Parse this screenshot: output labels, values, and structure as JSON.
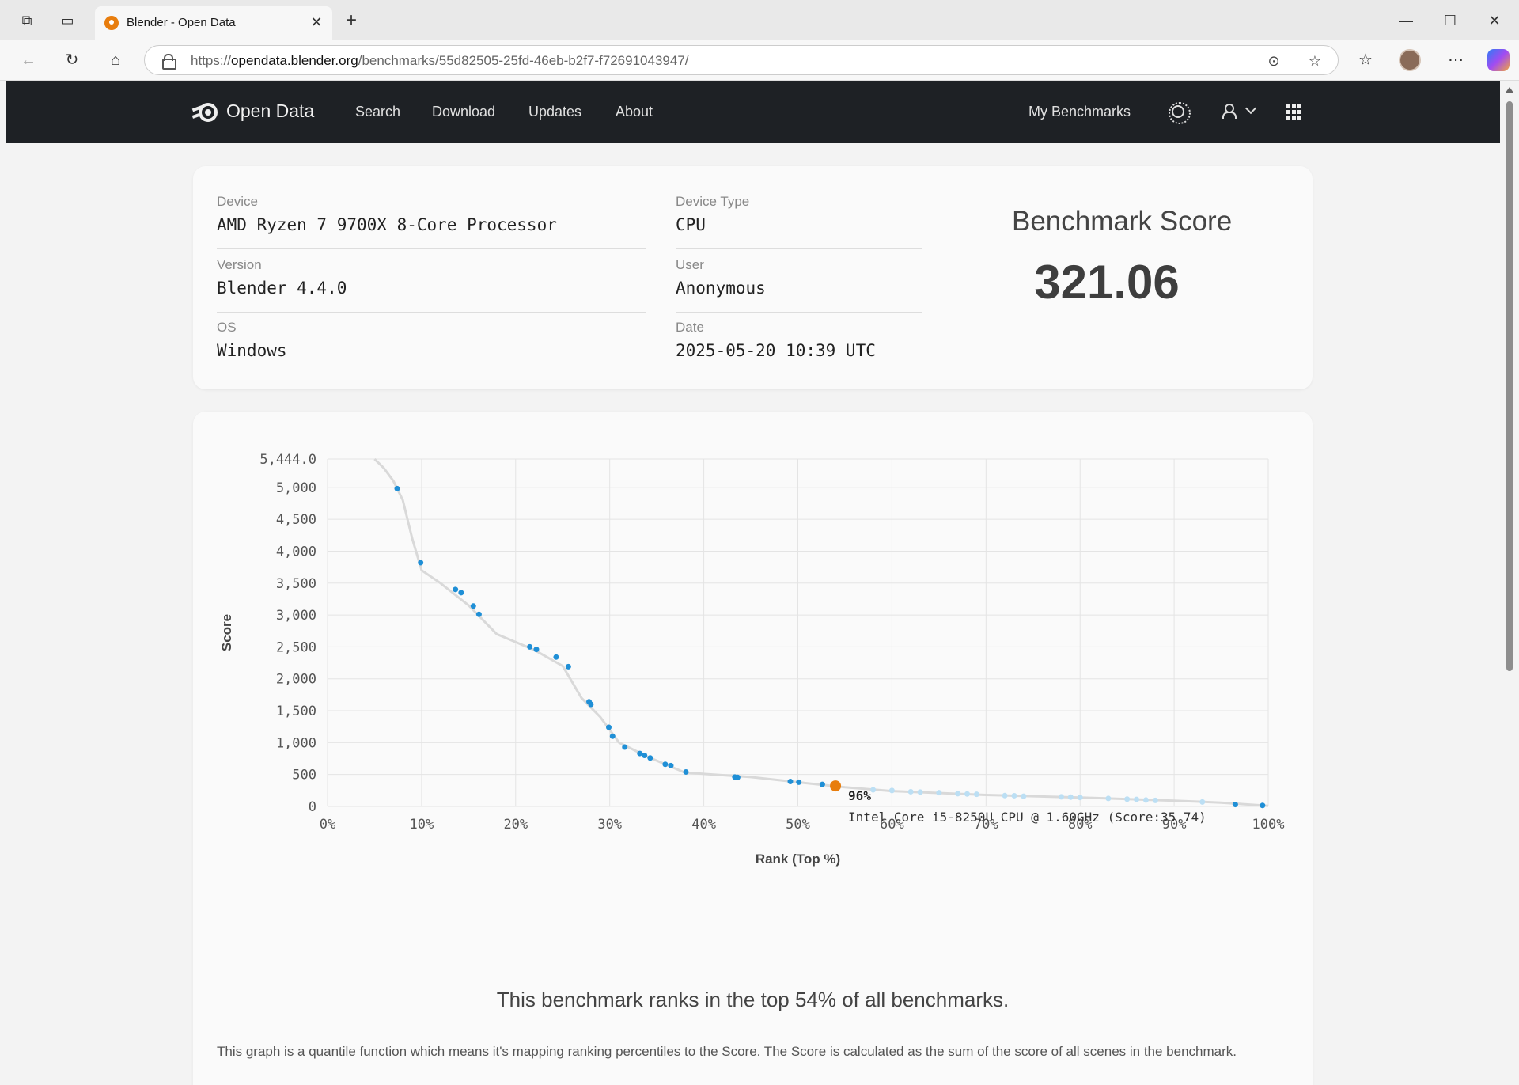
{
  "browser": {
    "tab_title": "Blender - Open Data",
    "url_prefix": "https://",
    "url_host": "opendata.blender.org",
    "url_path": "/benchmarks/55d82505-25fd-46eb-b2f7-f72691043947/"
  },
  "nav": {
    "brand": "Open Data",
    "links": [
      "Search",
      "Download",
      "Updates",
      "About"
    ],
    "my_benchmarks": "My Benchmarks"
  },
  "info": {
    "device_label": "Device",
    "device_value": "AMD Ryzen 7 9700X 8-Core Processor",
    "version_label": "Version",
    "version_value": "Blender 4.4.0",
    "os_label": "OS",
    "os_value": "Windows",
    "device_type_label": "Device Type",
    "device_type_value": "CPU",
    "user_label": "User",
    "user_value": "Anonymous",
    "date_label": "Date",
    "date_value": "2025-05-20 10:39 UTC",
    "score_title": "Benchmark Score",
    "score_value": "321.06"
  },
  "chart_data": {
    "type": "scatter",
    "xlabel": "Rank (Top %)",
    "ylabel": "Score",
    "xlim": [
      0,
      100
    ],
    "ylim": [
      0,
      5444
    ],
    "x_ticks": [
      "0%",
      "10%",
      "20%",
      "30%",
      "40%",
      "50%",
      "60%",
      "70%",
      "80%",
      "90%",
      "100%"
    ],
    "y_ticks": [
      "0",
      "500",
      "1,000",
      "1,500",
      "2,000",
      "2,500",
      "3,000",
      "3,500",
      "4,000",
      "4,500",
      "5,000",
      "5,444.0"
    ],
    "y_tick_values": [
      0,
      500,
      1000,
      1500,
      2000,
      2500,
      3000,
      3500,
      4000,
      4500,
      5000,
      5444
    ],
    "curve": [
      [
        5,
        5444
      ],
      [
        6,
        5300
      ],
      [
        7,
        5100
      ],
      [
        8,
        4800
      ],
      [
        9,
        4200
      ],
      [
        10,
        3700
      ],
      [
        12,
        3500
      ],
      [
        15,
        3150
      ],
      [
        18,
        2700
      ],
      [
        22,
        2450
      ],
      [
        25,
        2200
      ],
      [
        27,
        1700
      ],
      [
        29,
        1400
      ],
      [
        31,
        1000
      ],
      [
        34,
        780
      ],
      [
        38,
        530
      ],
      [
        45,
        460
      ],
      [
        50,
        380
      ],
      [
        55,
        300
      ],
      [
        60,
        240
      ],
      [
        70,
        180
      ],
      [
        80,
        140
      ],
      [
        90,
        90
      ],
      [
        95,
        60
      ],
      [
        100,
        10
      ]
    ],
    "points": [
      [
        7.4,
        4980
      ],
      [
        9.9,
        3820
      ],
      [
        13.6,
        3400
      ],
      [
        14.2,
        3350
      ],
      [
        15.5,
        3140
      ],
      [
        16.1,
        3010
      ],
      [
        21.5,
        2500
      ],
      [
        22.2,
        2460
      ],
      [
        24.3,
        2340
      ],
      [
        25.6,
        2190
      ],
      [
        27.8,
        1640
      ],
      [
        28,
        1600
      ],
      [
        29.9,
        1240
      ],
      [
        30.3,
        1100
      ],
      [
        31.6,
        930
      ],
      [
        33.2,
        830
      ],
      [
        33.7,
        800
      ],
      [
        34.3,
        760
      ],
      [
        35.9,
        660
      ],
      [
        36.5,
        640
      ],
      [
        38.1,
        540
      ],
      [
        43.3,
        460
      ],
      [
        43.6,
        455
      ],
      [
        49.2,
        390
      ],
      [
        50.1,
        380
      ],
      [
        52.6,
        345
      ],
      [
        96.5,
        30
      ],
      [
        99.4,
        15
      ]
    ],
    "faded_points": [
      [
        58,
        260
      ],
      [
        60,
        250
      ],
      [
        62,
        230
      ],
      [
        63,
        225
      ],
      [
        65,
        215
      ],
      [
        67,
        200
      ],
      [
        68,
        195
      ],
      [
        69,
        190
      ],
      [
        72,
        170
      ],
      [
        73,
        168
      ],
      [
        74,
        160
      ],
      [
        78,
        150
      ],
      [
        79,
        145
      ],
      [
        80,
        140
      ],
      [
        83,
        125
      ],
      [
        85,
        115
      ],
      [
        86,
        110
      ],
      [
        87,
        100
      ],
      [
        88,
        95
      ],
      [
        93,
        70
      ]
    ],
    "highlight": {
      "x": 54,
      "y": 321.06
    },
    "tooltip_percent": "96%",
    "tooltip_label": "Intel Core i5-8250U CPU @ 1.60GHz (Score:35.74)",
    "colors": {
      "point": "#1f8fd6",
      "faded": "#bcdff4",
      "curve": "#d9d9d9",
      "highlight": "#e87d0d",
      "grid": "#e4e4e4"
    }
  },
  "rank_text": "This benchmark ranks in the top 54% of all benchmarks.",
  "description": "This graph is a quantile function which means it's mapping ranking percentiles to the Score. The Score is calculated as the sum of the score of all scenes in the benchmark."
}
